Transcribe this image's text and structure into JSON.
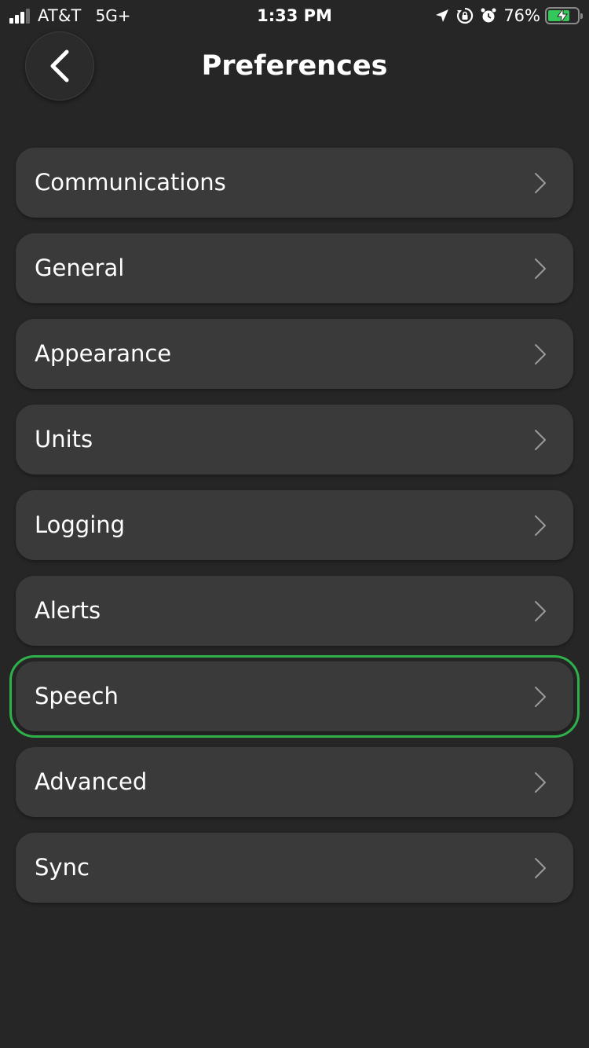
{
  "status_bar": {
    "carrier": "AT&T",
    "network": "5G+",
    "time": "1:33 PM",
    "battery_percent": "76%",
    "battery_level": 0.76,
    "icons": [
      "location-arrow-icon",
      "orientation-lock-icon",
      "alarm-clock-icon",
      "battery-charging-icon"
    ]
  },
  "header": {
    "title": "Preferences",
    "back_icon": "chevron-left-icon"
  },
  "menu": {
    "items": [
      {
        "label": "Communications",
        "selected": false
      },
      {
        "label": "General",
        "selected": false
      },
      {
        "label": "Appearance",
        "selected": false
      },
      {
        "label": "Units",
        "selected": false
      },
      {
        "label": "Logging",
        "selected": false
      },
      {
        "label": "Alerts",
        "selected": false
      },
      {
        "label": "Speech",
        "selected": true
      },
      {
        "label": "Advanced",
        "selected": false
      },
      {
        "label": "Sync",
        "selected": false
      }
    ]
  },
  "colors": {
    "background": "#262626",
    "item_background": "#3a3a3a",
    "selection_outline": "#2fb14a",
    "battery_fill": "#34c759"
  }
}
